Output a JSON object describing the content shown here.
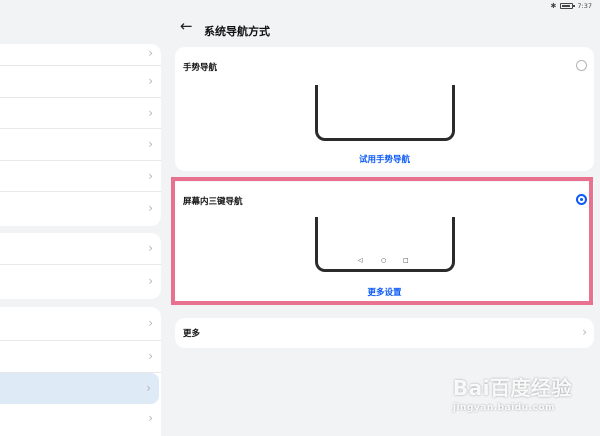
{
  "status_bar": {
    "time": "7:37"
  },
  "header": {
    "title": "系统导航方式"
  },
  "options": [
    {
      "title": "手势导航",
      "selected": false,
      "action_label": "试用手势导航"
    },
    {
      "title": "屏幕内三键导航",
      "selected": true,
      "action_label": "更多设置"
    }
  ],
  "more": {
    "label": "更多"
  },
  "icons": {
    "back": "back-arrow-icon",
    "chevron": "chevron-right-icon",
    "bluetooth": "bluetooth-icon",
    "battery": "battery-icon",
    "nav_back": "triangle-back-icon",
    "nav_home": "circle-home-icon",
    "nav_recent": "square-recent-icon"
  },
  "colors": {
    "accent": "#0a59f7",
    "background": "#f1f3f5",
    "highlight": "#e8718f",
    "selected_row": "#deeaf6"
  },
  "watermark": {
    "main": "Bai百度经验",
    "sub": "jingyan.baidu.com"
  }
}
